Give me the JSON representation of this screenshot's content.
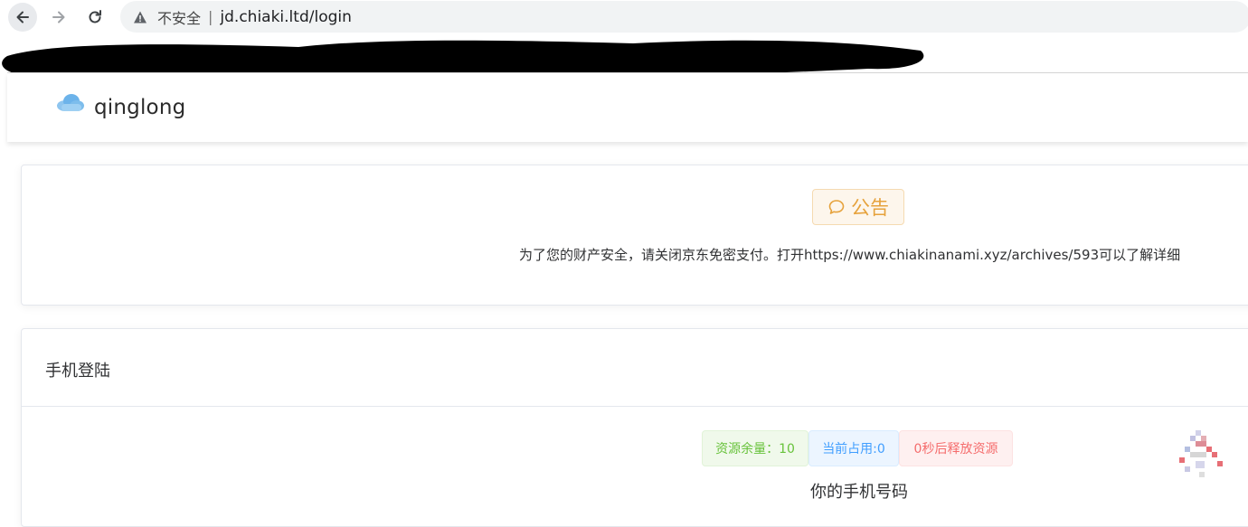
{
  "browser": {
    "security_label": "不安全",
    "separator": "|",
    "url": "jd.chiaki.ltd/login"
  },
  "app": {
    "title": "qinglong"
  },
  "notice": {
    "badge_label": "公告",
    "text": "为了您的财产安全，请关闭京东免密支付。打开https://www.chiakinanami.xyz/archives/593可以了解详细"
  },
  "login": {
    "title": "手机登陆",
    "tags": {
      "resources_remaining": "资源余量：10",
      "current_usage": "当前占用:0",
      "release_timer": "0秒后释放资源"
    },
    "phone_label": "你的手机号码"
  },
  "colors": {
    "warning": "#e6a23c",
    "success": "#67c23a",
    "primary": "#409eff",
    "danger": "#f56c6c"
  },
  "icons": [
    "back-arrow-icon",
    "forward-arrow-icon",
    "reload-icon",
    "warning-triangle-icon",
    "cloud-logo-icon",
    "chat-bubble-icon"
  ]
}
